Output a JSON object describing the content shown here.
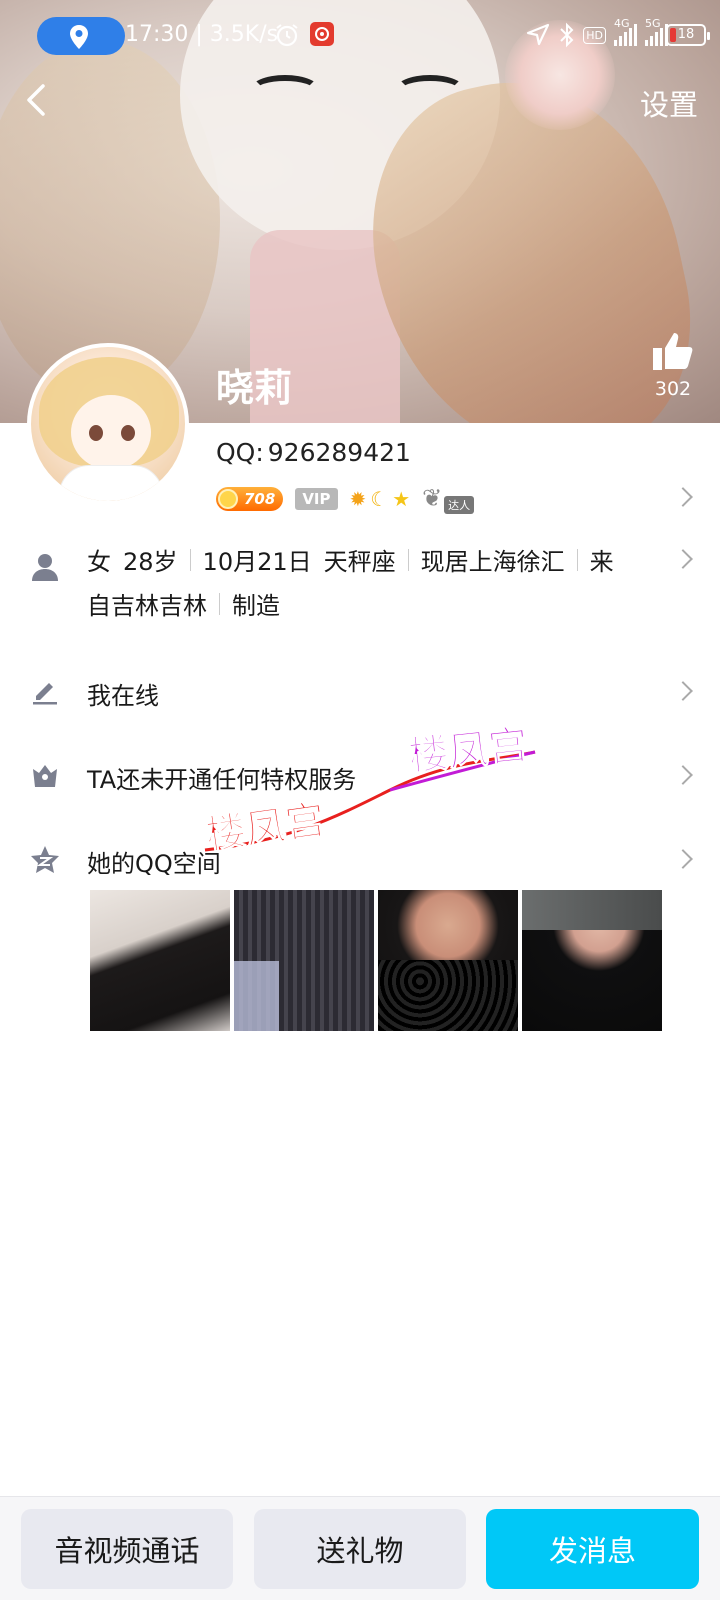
{
  "status_bar": {
    "time_speed": "17:30 | 3.5K/s",
    "net1": "4G",
    "net2": "5G",
    "hd": "HD",
    "battery": "18"
  },
  "header": {
    "settings_label": "设置",
    "likes": "302"
  },
  "profile": {
    "nickname": "晓莉",
    "qq_label": "QQ:",
    "qq_number": "926289421",
    "level": "708",
    "vip": "VIP",
    "daren": "达人"
  },
  "info": {
    "gender": "女",
    "age": "28岁",
    "birthday": "10月21日",
    "zodiac": "天秤座",
    "location": "现居上海徐汇",
    "from_prefix": "来",
    "from_rest": "自吉林吉林",
    "job": "制造"
  },
  "rows": {
    "status": "我在线",
    "privilege": "TA还未开通任何特权服务",
    "qzone": "她的QQ空间"
  },
  "watermark": {
    "text1": "楼凤宫",
    "text2": "楼凤宫"
  },
  "bottom_bar": {
    "call": "音视频通话",
    "gift": "送礼物",
    "message": "发消息"
  },
  "colors": {
    "primary": "#00c8f7",
    "secondary_button": "#e8e9f0",
    "location_pill": "#2f7fe8",
    "watermark_red": "#e8201e",
    "watermark_purple": "#c21bd6"
  }
}
